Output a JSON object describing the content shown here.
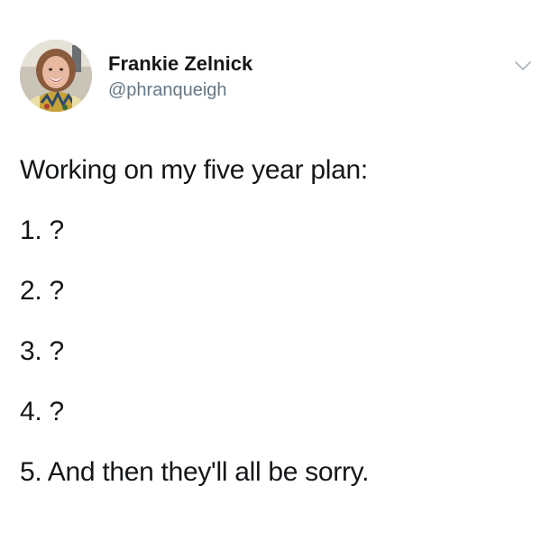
{
  "author": {
    "name": "Frankie Zelnick",
    "handle": "@phranqueigh",
    "avatar_icon": "profile-photo"
  },
  "header": {
    "menu_icon": "chevron-down-icon",
    "menu_icon_color": "#aab8c2"
  },
  "tweet": {
    "intro": "Working on my five year plan:",
    "items": [
      "1. ?",
      "2. ?",
      "3. ?",
      "4. ?",
      "5. And then they'll all be sorry."
    ]
  },
  "colors": {
    "text": "#14171a",
    "secondary": "#657786",
    "background": "#ffffff"
  }
}
